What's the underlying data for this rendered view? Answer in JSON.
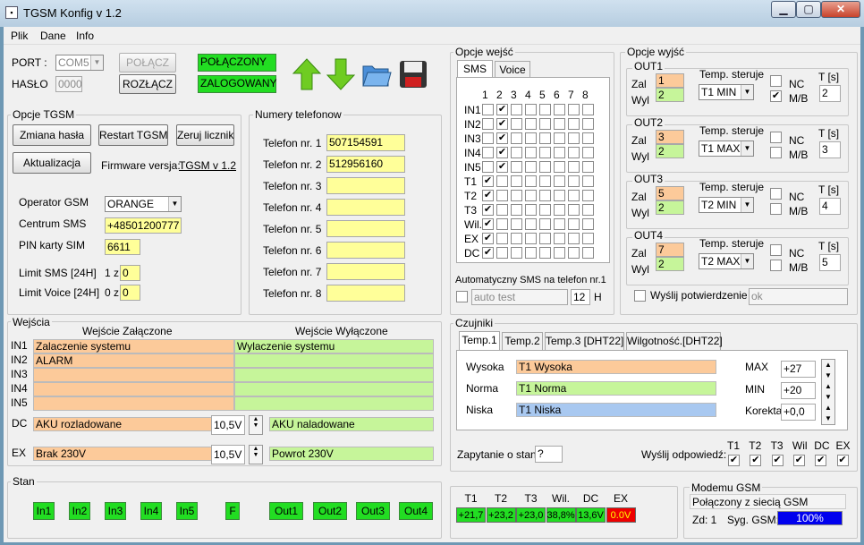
{
  "window": {
    "title": "TGSM Konfig v 1.2"
  },
  "menu": [
    "Plik",
    "Dane",
    "Info"
  ],
  "connection": {
    "port_label": "PORT :",
    "port_value": "COM5",
    "password_label": "HASŁO",
    "password_value": "0000",
    "connect": "POŁĄCZ",
    "disconnect": "ROZŁĄCZ",
    "status_connected": "POŁĄCZONY",
    "status_logged": "ZALOGOWANY"
  },
  "tgsm": {
    "legend": "Opcje TGSM",
    "change_pass": "Zmiana hasła",
    "restart": "Restart TGSM",
    "reset_counters": "Zeruj liczniki",
    "update": "Aktualizacja",
    "fw_label": "Firmware versja:",
    "fw_value": "TGSM v 1.2",
    "operator_label": "Operator GSM",
    "operator_value": "ORANGE",
    "sms_center_label": "Centrum SMS",
    "sms_center_value": "+48501200777",
    "pin_label": "PIN karty SIM",
    "pin_value": "6611",
    "limit_sms_label": "Limit SMS  [24H]",
    "limit_sms_prefix": "1 z",
    "limit_sms_value": "0",
    "limit_voice_label": "Limit Voice [24H]",
    "limit_voice_prefix": "0 z",
    "limit_voice_value": "0"
  },
  "phones": {
    "legend": "Numery telefonow",
    "items": [
      {
        "label": "Telefon nr. 1",
        "value": "507154591"
      },
      {
        "label": "Telefon nr. 2",
        "value": "512956160"
      },
      {
        "label": "Telefon nr. 3",
        "value": ""
      },
      {
        "label": "Telefon nr. 4",
        "value": ""
      },
      {
        "label": "Telefon nr. 5",
        "value": ""
      },
      {
        "label": "Telefon nr. 6",
        "value": ""
      },
      {
        "label": "Telefon nr. 7",
        "value": ""
      },
      {
        "label": "Telefon nr. 8",
        "value": ""
      }
    ]
  },
  "inputs_opts": {
    "legend": "Opcje wejść",
    "tab_sms": "SMS",
    "tab_voice": "Voice",
    "cols": [
      "1",
      "2",
      "3",
      "4",
      "5",
      "6",
      "7",
      "8"
    ],
    "rows": [
      {
        "label": "IN1",
        "checks": [
          false,
          true,
          false,
          false,
          false,
          false,
          false,
          false
        ]
      },
      {
        "label": "IN2",
        "checks": [
          false,
          true,
          false,
          false,
          false,
          false,
          false,
          false
        ]
      },
      {
        "label": "IN3",
        "checks": [
          false,
          true,
          false,
          false,
          false,
          false,
          false,
          false
        ]
      },
      {
        "label": "IN4",
        "checks": [
          false,
          true,
          false,
          false,
          false,
          false,
          false,
          false
        ]
      },
      {
        "label": "IN5",
        "checks": [
          false,
          true,
          false,
          false,
          false,
          false,
          false,
          false
        ]
      },
      {
        "label": "T1",
        "checks": [
          true,
          false,
          false,
          false,
          false,
          false,
          false,
          false
        ]
      },
      {
        "label": "T2",
        "checks": [
          true,
          false,
          false,
          false,
          false,
          false,
          false,
          false
        ]
      },
      {
        "label": "T3",
        "checks": [
          true,
          false,
          false,
          false,
          false,
          false,
          false,
          false
        ]
      },
      {
        "label": "Wil.",
        "checks": [
          true,
          false,
          false,
          false,
          false,
          false,
          false,
          false
        ]
      },
      {
        "label": "EX",
        "checks": [
          true,
          false,
          false,
          false,
          false,
          false,
          false,
          false
        ]
      },
      {
        "label": "DC",
        "checks": [
          true,
          false,
          false,
          false,
          false,
          false,
          false,
          false
        ]
      }
    ],
    "auto_sms_label": "Automatyczny SMS na telefon nr.1",
    "auto_sms_placeholder": "auto test",
    "auto_sms_hours": "12",
    "hours_unit": "H"
  },
  "outputs_opts": {
    "legend": "Opcje wyjść",
    "zal": "Zal",
    "wyl": "Wyl",
    "temp_label": "Temp. steruje",
    "nc": "NC",
    "mb": "M/B",
    "t_label": "T [s]",
    "items": [
      {
        "name": "OUT1",
        "zal": "1",
        "wyl": "2",
        "temp": "T1 MIN",
        "nc": false,
        "mb": true,
        "t": "2"
      },
      {
        "name": "OUT2",
        "zal": "3",
        "wyl": "2",
        "temp": "T1 MAX",
        "nc": false,
        "mb": false,
        "t": "3"
      },
      {
        "name": "OUT3",
        "zal": "5",
        "wyl": "2",
        "temp": "T2 MIN",
        "nc": false,
        "mb": false,
        "t": "4"
      },
      {
        "name": "OUT4",
        "zal": "7",
        "wyl": "2",
        "temp": "T2 MAX",
        "nc": false,
        "mb": false,
        "t": "5"
      }
    ],
    "confirm_label": "Wyślij potwierdzenie",
    "confirm_value": "ok"
  },
  "wejscia": {
    "legend": "Wejścia",
    "col_on": "Wejście Załączone",
    "col_off": "Wejście Wyłączone",
    "rows": [
      {
        "label": "IN1",
        "on": "Zalaczenie systemu",
        "off": "Wylaczenie systemu"
      },
      {
        "label": "IN2",
        "on": "ALARM",
        "off": ""
      },
      {
        "label": "IN3",
        "on": "",
        "off": ""
      },
      {
        "label": "IN4",
        "on": "",
        "off": ""
      },
      {
        "label": "IN5",
        "on": "",
        "off": ""
      }
    ],
    "dc_label": "DC",
    "dc_on": "AKU rozladowane",
    "dc_threshold": "10,5V",
    "dc_off": "AKU naladowane",
    "ex_label": "EX",
    "ex_on": "Brak 230V",
    "ex_threshold": "10,5V",
    "ex_off": "Powrot 230V"
  },
  "sensors": {
    "legend": "Czujniki",
    "tabs": [
      "Temp.1",
      "Temp.2",
      "Temp.3 [DHT22]",
      "Wilgotność.[DHT22]"
    ],
    "high_label": "Wysoka",
    "high_value": "T1 Wysoka",
    "norm_label": "Norma",
    "norm_value": "T1 Norma",
    "low_label": "Niska",
    "low_value": "T1 Niska",
    "max_label": "MAX",
    "max_value": "+27",
    "min_label": "MIN",
    "min_value": "+20",
    "corr_label": "Korekta",
    "corr_value": "+0,0",
    "query_label": "Zapytanie o stan:",
    "query_value": "?",
    "reply_label": "Wyślij odpowiedź:",
    "reply_cols": [
      {
        "label": "T1",
        "checked": true
      },
      {
        "label": "T2",
        "checked": true
      },
      {
        "label": "T3",
        "checked": true
      },
      {
        "label": "Wil",
        "checked": true
      },
      {
        "label": "DC",
        "checked": true
      },
      {
        "label": "EX",
        "checked": true
      }
    ]
  },
  "stan": {
    "legend": "Stan",
    "indicators": [
      "In1",
      "In2",
      "In3",
      "In4",
      "In5",
      "F",
      "Out1",
      "Out2",
      "Out3",
      "Out4"
    ]
  },
  "readings": {
    "headers": [
      "T1",
      "T2",
      "T3",
      "Wil.",
      "DC",
      "EX"
    ],
    "values": [
      "+21,7",
      "+23,2",
      "+23,0",
      "38,8%",
      "13,6V",
      "0.0V"
    ]
  },
  "modem": {
    "legend": "Modemu GSM",
    "status": "Połączony z siecią GSM",
    "zd_label": "Zd: 1",
    "signal_label": "Syg. GSM:",
    "signal_value": "100%",
    "signal_level": 1.0
  },
  "colors": {
    "green_ok": "#22dd22",
    "red_alarm": "#ee0000",
    "signal_blue": "#0000ee"
  }
}
